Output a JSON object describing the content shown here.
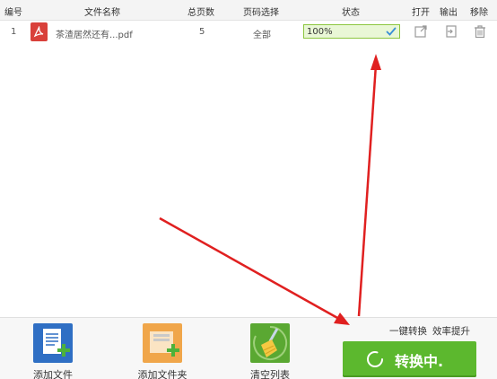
{
  "table": {
    "columns": [
      "编号",
      "文件名称",
      "总页数",
      "页码选择",
      "状态",
      "打开",
      "输出",
      "移除"
    ],
    "rows": [
      {
        "index": "1",
        "filename": "茶渣居然还有...pdf",
        "pages": "5",
        "page_selection": "全部",
        "status": "100%",
        "file_type_icon": "pdf-icon",
        "open_icon": "open-external-icon",
        "output_icon": "output-icon",
        "remove_icon": "trash-icon"
      }
    ]
  },
  "toolbar": {
    "add_file": "添加文件",
    "add_folder": "添加文件夹",
    "clear_list": "清空列表",
    "slogan_1": "一键转换",
    "slogan_2": "效率提升",
    "convert": "转换中."
  },
  "colors": {
    "accent_green": "#5cb82e",
    "status_fill": "#e9f7d6",
    "annotation_arrow": "#e02020",
    "pdf_red": "#d9403a"
  }
}
